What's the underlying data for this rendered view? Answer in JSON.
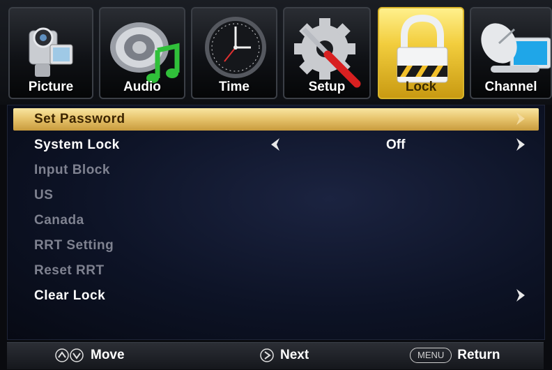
{
  "tabs": [
    {
      "label": "Picture",
      "icon": "camcorder-icon"
    },
    {
      "label": "Audio",
      "icon": "speaker-music-icon"
    },
    {
      "label": "Time",
      "icon": "clock-icon"
    },
    {
      "label": "Setup",
      "icon": "gear-tools-icon"
    },
    {
      "label": "Lock",
      "icon": "padlock-icon"
    },
    {
      "label": "Channel",
      "icon": "satellite-dish-icon"
    }
  ],
  "active_tab": "Lock",
  "menu": {
    "items": [
      {
        "label": "Set Password",
        "state": "highlighted"
      },
      {
        "label": "System Lock",
        "state": "enabled",
        "value": "Off"
      },
      {
        "label": "Input Block",
        "state": "disabled"
      },
      {
        "label": "US",
        "state": "disabled"
      },
      {
        "label": "Canada",
        "state": "disabled"
      },
      {
        "label": "RRT Setting",
        "state": "disabled"
      },
      {
        "label": "Reset RRT",
        "state": "disabled"
      },
      {
        "label": "Clear Lock",
        "state": "enabled"
      }
    ]
  },
  "footer": {
    "move_label": "Move",
    "next_label": "Next",
    "menu_key": "MENU",
    "return_label": "Return"
  },
  "colors": {
    "accent_gold": "#f2cd3d",
    "highlight_row": "#e8c56e",
    "disabled_text": "#7f8290",
    "background_navy": "#0d1326"
  }
}
